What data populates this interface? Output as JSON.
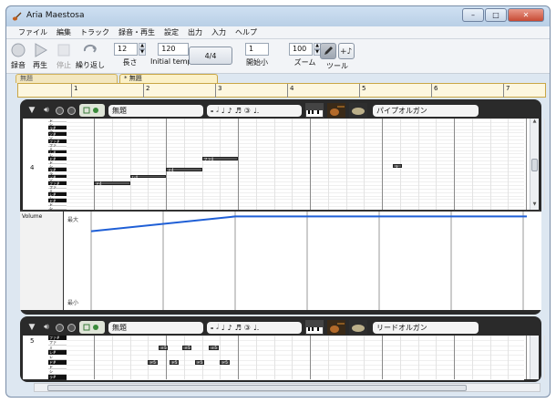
{
  "window": {
    "title": "Aria Maestosa",
    "controls": {
      "minimize": "–",
      "maximize": "□",
      "close": "✕"
    }
  },
  "menubar": [
    {
      "label": "ファイル"
    },
    {
      "label": "編集"
    },
    {
      "label": "トラック"
    },
    {
      "label": "録音・再生"
    },
    {
      "label": "設定"
    },
    {
      "label": "出力"
    },
    {
      "label": "入力"
    },
    {
      "label": "ヘルプ"
    }
  ],
  "toolbar": {
    "record_label": "録音",
    "play_label": "再生",
    "stop_label": "停止",
    "loop_label": "繰り返し",
    "length_value": "12",
    "length_label": "長さ",
    "tempo_value": "120",
    "tempo_label": "Initial tempo",
    "time_signature": "4/4",
    "start_value": "1",
    "start_label": "開始小",
    "zoom_value": "100",
    "zoom_label": "ズーム",
    "tools_label": "ツール"
  },
  "tabs": [
    {
      "label": "無題",
      "active": false
    },
    {
      "label": "* 無題",
      "active": true
    }
  ],
  "ruler": {
    "measures": [
      "1",
      "2",
      "3",
      "4",
      "5",
      "6",
      "7"
    ]
  },
  "tracks": [
    {
      "name": "無題",
      "instrument": "パイプオルガン",
      "octave_label": "4",
      "keys": [
        "ド",
        "シ",
        "ラ#",
        "ラ",
        "ソ#",
        "ソ",
        "ファ#",
        "ファ",
        "ミ",
        "レ#",
        "レ",
        "ド#",
        "ド",
        "シ",
        "ラ#",
        "ラ",
        "ソ#",
        "ソ",
        "ファ#",
        "ファ",
        "ミ",
        "レ#",
        "レ",
        "ド#",
        "ド",
        "シ"
      ],
      "notes": [
        {
          "label": "ド4",
          "measure": 1.0,
          "length": 0.5,
          "key_index": 18
        },
        {
          "label": "レ4",
          "measure": 1.5,
          "length": 0.5,
          "key_index": 16
        },
        {
          "label": "ミ4",
          "measure": 2.0,
          "length": 0.5,
          "key_index": 14
        },
        {
          "label": "ファ4",
          "measure": 2.5,
          "length": 0.5,
          "key_index": 11
        },
        {
          "label": "ラ",
          "measure": 5.15,
          "length": 0.13,
          "key_index": 13
        }
      ],
      "controller": {
        "label": "Volume",
        "max_label": "最大",
        "min_label": "最小",
        "points": [
          {
            "measure": 1.0,
            "level": 0.8
          },
          {
            "measure": 3.0,
            "level": 0.95
          },
          {
            "measure": 7.0,
            "level": 0.95
          }
        ]
      }
    },
    {
      "name": "無題",
      "instrument": "リードオルガン",
      "octave_label": "5",
      "keys": [
        "ファ#",
        "ファ",
        "ミ",
        "レ#",
        "レ",
        "ド#",
        "ド",
        "シ",
        "ラ#"
      ],
      "notes": [
        {
          "label": "ミ5",
          "measure": 1.9,
          "length": 0.13,
          "key_index": 2
        },
        {
          "label": "ミ5",
          "measure": 2.23,
          "length": 0.13,
          "key_index": 2
        },
        {
          "label": "ミ5",
          "measure": 2.6,
          "length": 0.13,
          "key_index": 2
        },
        {
          "label": "ド5",
          "measure": 1.75,
          "length": 0.13,
          "key_index": 5
        },
        {
          "label": "ド5",
          "measure": 2.05,
          "length": 0.13,
          "key_index": 5
        },
        {
          "label": "ド5",
          "measure": 2.4,
          "length": 0.13,
          "key_index": 5
        },
        {
          "label": "ド5",
          "measure": 2.75,
          "length": 0.13,
          "key_index": 5
        }
      ]
    }
  ],
  "colors": {
    "accent": "#1f5fd6",
    "tab_bg": "#fbf1c8",
    "track_frame": "#2a2a2a"
  }
}
